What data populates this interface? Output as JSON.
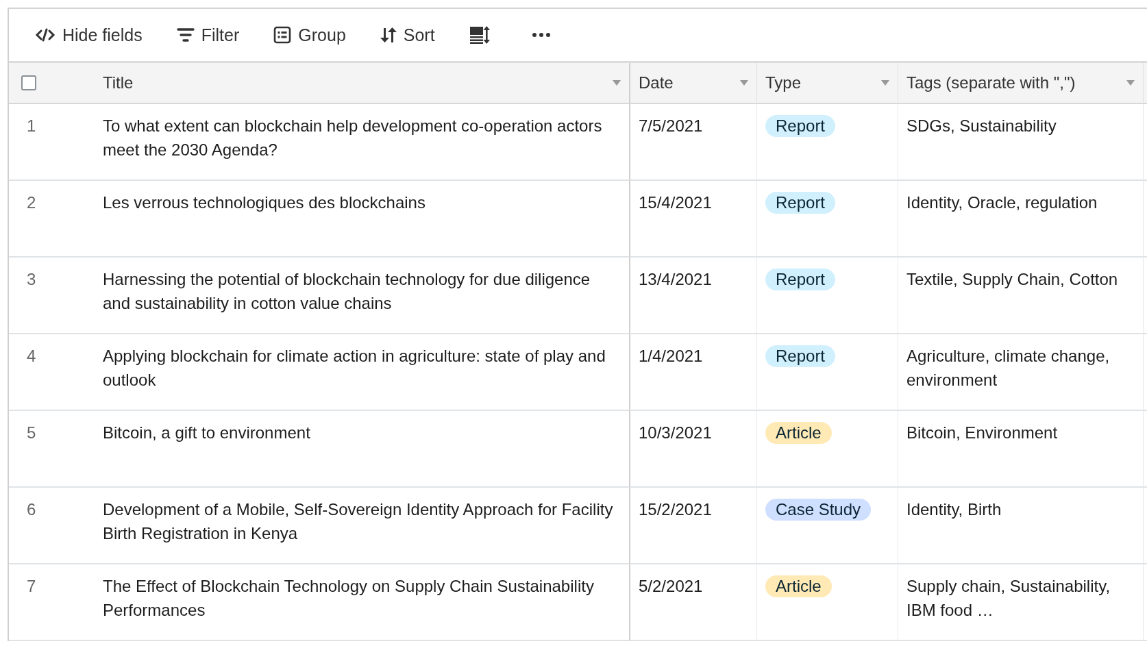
{
  "toolbar": [
    {
      "kind": "hide",
      "label": "Hide fields"
    },
    {
      "kind": "filter",
      "label": "Filter"
    },
    {
      "kind": "group",
      "label": "Group"
    },
    {
      "kind": "sort",
      "label": "Sort"
    },
    {
      "kind": "height"
    },
    {
      "kind": "more"
    }
  ],
  "table": {
    "select_all": {
      "checked": false
    },
    "columns": [
      "Title",
      "Date",
      "Type",
      "Tags (separate with \",\")"
    ],
    "rows": [
      {
        "number": "1",
        "title": "To what extent can blockchain help development co-operation actors meet the 2030 Agenda?",
        "date": "7/5/2021",
        "type": {
          "label": "Report",
          "color": "#d0f0fd"
        },
        "tags": "SDGs, Sustainability"
      },
      {
        "number": "2",
        "title": "Les verrous technologiques des blockchains",
        "date": "15/4/2021",
        "type": {
          "label": "Report",
          "color": "#d0f0fd"
        },
        "tags": "Identity, Oracle, regulation"
      },
      {
        "number": "3",
        "title": "Harnessing the potential of blockchain technology for due diligence and sustainability in cotton value chains",
        "date": "13/4/2021",
        "type": {
          "label": "Report",
          "color": "#d0f0fd"
        },
        "tags": "Textile, Supply Chain, Cotton"
      },
      {
        "number": "4",
        "title": "Applying blockchain for climate action in agriculture: state of play and outlook",
        "date": "1/4/2021",
        "type": {
          "label": "Report",
          "color": "#d0f0fd"
        },
        "tags": "Agriculture, climate change, environment"
      },
      {
        "number": "5",
        "title": "Bitcoin, a gift to environment",
        "date": "10/3/2021",
        "type": {
          "label": "Article",
          "color": "#ffeab6"
        },
        "tags": "Bitcoin, Environment"
      },
      {
        "number": "6",
        "title": "Development of a Mobile, Self-Sovereign Identity Approach for Facility Birth Registration in Kenya",
        "date": "15/2/2021",
        "type": {
          "label": "Case Study",
          "color": "#cfdfff"
        },
        "tags": "Identity, Birth"
      },
      {
        "number": "7",
        "title": "The Effect of Blockchain Technology on Supply Chain Sustainability Performances",
        "date": "5/2/2021",
        "type": {
          "label": "Article",
          "color": "#ffeab6"
        },
        "tags": "Supply chain, Sustainability, IBM food …"
      }
    ]
  }
}
